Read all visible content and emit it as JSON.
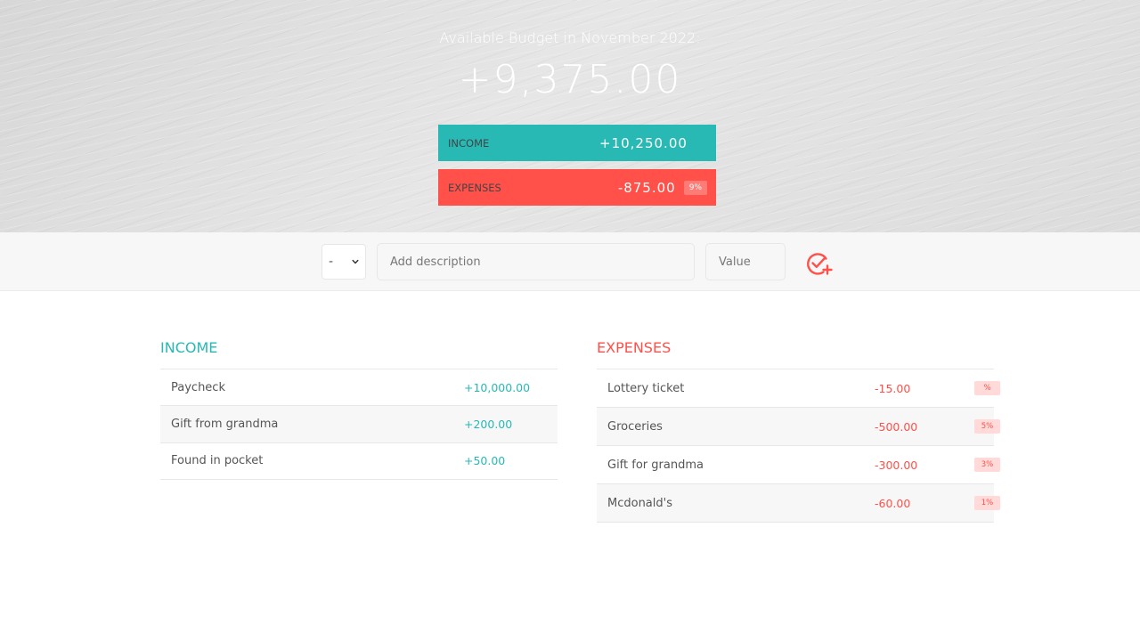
{
  "header": {
    "budget_title": "Available Budget in November 2022:",
    "budget_value": "+9,375.00",
    "income_label": "INCOME",
    "income_value": "+10,250.00",
    "expenses_label": "EXPENSES",
    "expenses_value": "-875.00",
    "expenses_percentage": "9%"
  },
  "add_form": {
    "type_value": "-",
    "description_placeholder": "Add description",
    "value_placeholder": "Value",
    "add_icon": "check-circle-plus-icon"
  },
  "income": {
    "title": "INCOME",
    "items": [
      {
        "description": "Paycheck",
        "value": "+10,000.00"
      },
      {
        "description": "Gift from grandma",
        "value": "+200.00"
      },
      {
        "description": "Found in pocket",
        "value": "+50.00"
      }
    ]
  },
  "expenses": {
    "title": "EXPENSES",
    "items": [
      {
        "description": "Lottery ticket",
        "value": "-15.00",
        "percentage": "%"
      },
      {
        "description": "Groceries",
        "value": "-500.00",
        "percentage": "5%"
      },
      {
        "description": "Gift for grandma",
        "value": "-300.00",
        "percentage": "3%"
      },
      {
        "description": "Mcdonald's",
        "value": "-60.00",
        "percentage": "1%"
      }
    ]
  },
  "colors": {
    "income_accent": "#28b9b5",
    "expenses_accent": "#ff5049",
    "percentage_badge_bg": "#ffdad9"
  }
}
